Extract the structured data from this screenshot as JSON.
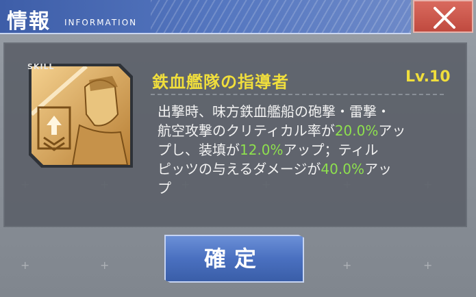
{
  "header": {
    "title": "情報",
    "subtitle": "INFORMATION"
  },
  "skill": {
    "badge": "SKILL",
    "name": "鉄血艦隊の指導者",
    "level": "Lv.10",
    "description": {
      "line1": "出撃時、味方鉄血艦船の砲撃・雷撃・",
      "line2_pre": "航空攻撃のクリティカル率が",
      "val1": "20.0%",
      "line2_post": "アッ",
      "line3_pre": "プし、装填が",
      "val2": "12.0%",
      "line3_post": "アップ；ティル",
      "line4_pre": "ピッツの与えるダメージが",
      "val3": "40.0%",
      "line4_post": "アッ",
      "line5": "プ"
    }
  },
  "confirm_label": "確定",
  "colors": {
    "header": "#4a6bb5",
    "close": "#c9554a",
    "skill_name": "#f0de3c",
    "highlight": "#8ee04e",
    "confirm": "#5275c4"
  },
  "icons": [
    "close-icon",
    "skill-icon"
  ]
}
